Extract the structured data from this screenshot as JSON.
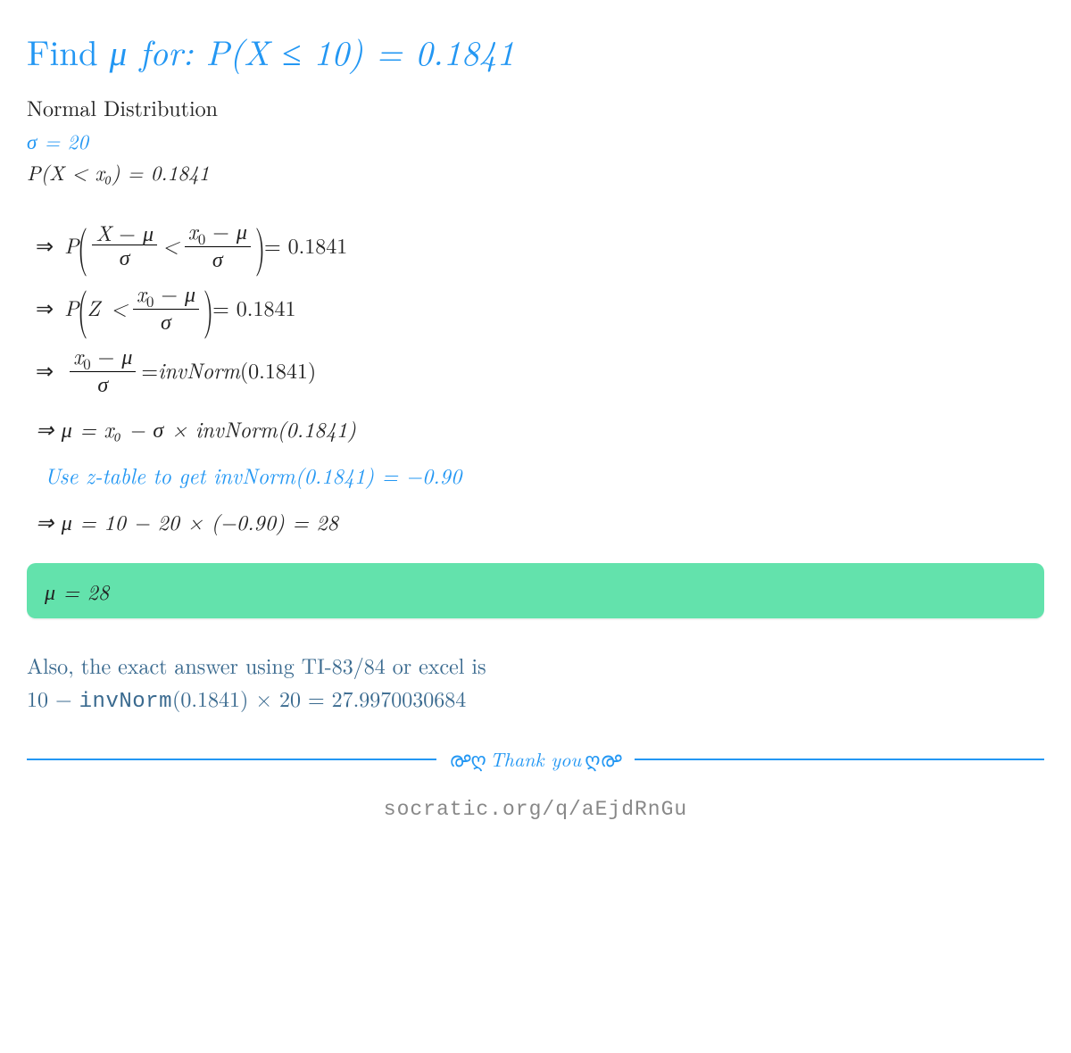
{
  "title_pre": "Find ",
  "title_math": "μ for:  P(X ≤ 10) = 0.1841",
  "sub": "Normal Distribution",
  "sigma": "σ = 20",
  "pline": "P(X < x₀) = 0.1841",
  "step1_rhs": " = 0.1841",
  "step2_rhs": " = 0.1841",
  "step3_pre": " = ",
  "step3_fn": "invNorm",
  "step3_arg": "(0.1841)",
  "step4": "⇒ μ = x₀ − σ × invNorm(0.1841)",
  "note": "Use z-table to get invNorm(0.1841) = −0.90",
  "step5": "⇒ μ = 10 − 20 × (−0.90) = 28",
  "answer": "μ = 28",
  "calc_line1": "Also, the exact answer using TI-83/84 or excel is",
  "calc_line2_pre": "10 − ",
  "calc_line2_fn": "invNorm",
  "calc_line2_post": "(0.1841) × 20 = 27.9970030684",
  "thank": "Thank you",
  "source": "socratic.org/q/aEjdRnGu",
  "sym": {
    "arrow": "⇒",
    "P": "P",
    "Z": "Z",
    "lt": "<",
    "X": "X",
    "mu": "μ",
    "sigma": "σ",
    "x0": "x",
    "zero": "0",
    "minus": "−"
  }
}
